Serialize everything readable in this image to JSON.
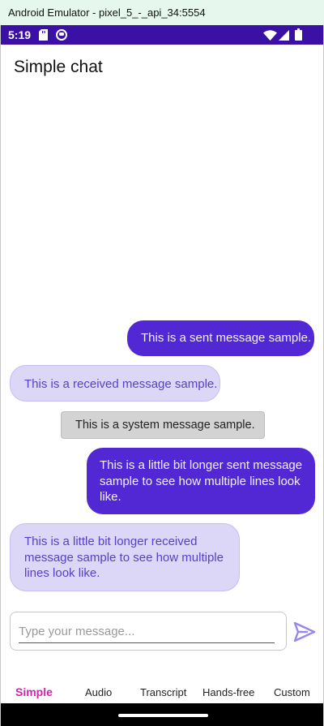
{
  "window": {
    "title": "Android Emulator - pixel_5_-_api_34:5554"
  },
  "status_bar": {
    "time": "5:19",
    "icons": [
      "sd-card-icon",
      "app-notification-icon",
      "wifi-icon",
      "signal-icon",
      "battery-icon"
    ]
  },
  "page": {
    "title": "Simple chat"
  },
  "messages": [
    {
      "type": "sent",
      "text": "This is a sent message sample."
    },
    {
      "type": "received",
      "text": "This is a received message sample."
    },
    {
      "type": "system",
      "text": "This is a system message sample."
    },
    {
      "type": "sent",
      "text": "This is a little bit longer sent message sample to see how multiple lines look like."
    },
    {
      "type": "received",
      "text": "This is a little bit longer received message sample to see how multiple lines look like."
    }
  ],
  "composer": {
    "placeholder": "Type your message...",
    "send_icon": "send-icon"
  },
  "tabs": [
    {
      "label": "Simple",
      "active": true
    },
    {
      "label": "Audio",
      "active": false
    },
    {
      "label": "Transcript",
      "active": false
    },
    {
      "label": "Hands-free",
      "active": false
    },
    {
      "label": "Custom",
      "active": false
    }
  ],
  "colors": {
    "status_bar": "#3a10a5",
    "sent_bubble": "#5128d4",
    "received_bubble": "#dcd6f7",
    "received_text": "#5a40c8",
    "system_bubble": "#d3d3d3",
    "active_tab": "#d51fae",
    "send_icon": "#9b86ec"
  }
}
